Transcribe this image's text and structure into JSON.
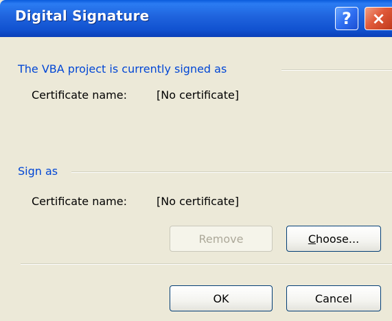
{
  "window": {
    "title": "Digital Signature",
    "help_glyph": "?",
    "close_glyph": "×"
  },
  "current_group": {
    "title": "The VBA project is currently signed as",
    "cert_label": "Certificate name:",
    "cert_value": "[No certificate]"
  },
  "sign_group": {
    "title": "Sign as",
    "cert_label": "Certificate name:",
    "cert_value": "[No certificate]"
  },
  "buttons": {
    "remove": "Remove",
    "choose_accel": "C",
    "choose_rest": "hoose...",
    "ok": "OK",
    "cancel": "Cancel"
  },
  "colors": {
    "titlebar": "#1f63dd",
    "group_title": "#0046d5",
    "dialog_bg": "#ece9d8"
  }
}
